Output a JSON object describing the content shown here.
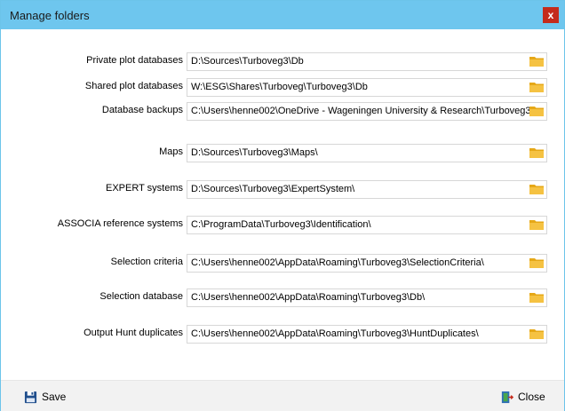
{
  "window": {
    "title": "Manage folders",
    "close_glyph": "x"
  },
  "fields": [
    {
      "label": "Private plot databases",
      "value": "D:\\Sources\\Turboveg3\\Db",
      "icon": "folder-icon"
    },
    {
      "label": "Shared plot databases",
      "value": "W:\\ESG\\Shares\\Turboveg\\Turboveg3\\Db",
      "icon": "folder-icon"
    },
    {
      "label": "Database backups",
      "value": "C:\\Users\\henne002\\OneDrive - Wageningen University & Research\\Turboveg3",
      "icon": "folder-icon"
    },
    {
      "label": "Maps",
      "value": "D:\\Sources\\Turboveg3\\Maps\\",
      "icon": "folder-icon"
    },
    {
      "label": "EXPERT systems",
      "value": "D:\\Sources\\Turboveg3\\ExpertSystem\\",
      "icon": "folder-icon"
    },
    {
      "label": "ASSOCIA reference systems",
      "value": "C:\\ProgramData\\Turboveg3\\Identification\\",
      "icon": "folder-icon"
    },
    {
      "label": "Selection criteria",
      "value": "C:\\Users\\henne002\\AppData\\Roaming\\Turboveg3\\SelectionCriteria\\",
      "icon": "folder-icon"
    },
    {
      "label": "Selection database",
      "value": "C:\\Users\\henne002\\AppData\\Roaming\\Turboveg3\\Db\\",
      "icon": "folder-icon"
    },
    {
      "label": "Output Hunt duplicates",
      "value": "C:\\Users\\henne002\\AppData\\Roaming\\Turboveg3\\HuntDuplicates\\",
      "icon": "folder-icon"
    }
  ],
  "footer": {
    "save_label": "Save",
    "close_label": "Close"
  },
  "colors": {
    "titlebar": "#6ec6ee",
    "close": "#c42b1c",
    "folder": "#f5c242"
  }
}
